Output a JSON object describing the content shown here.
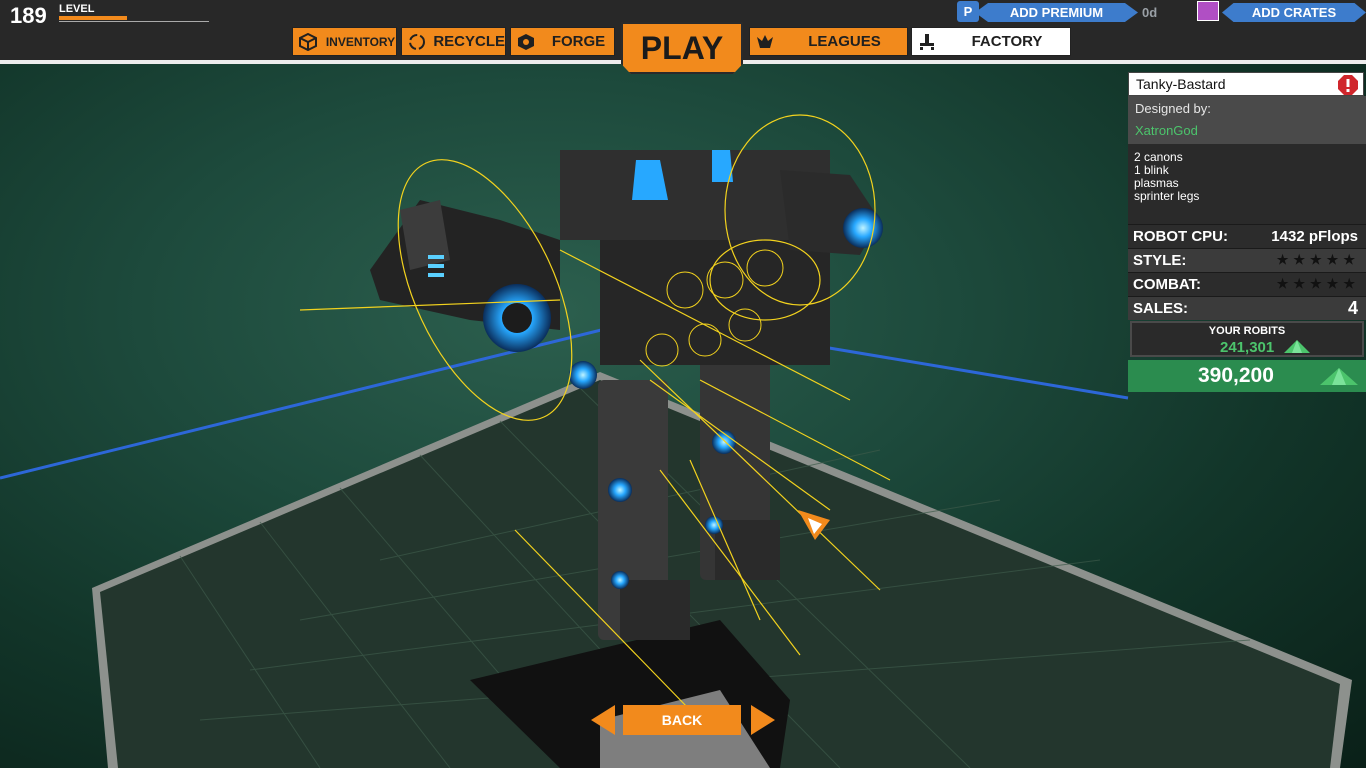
{
  "player": {
    "level": "189",
    "level_label": "LEVEL",
    "xp_progress": 0.45
  },
  "nav": {
    "inventory": "INVENTORY",
    "recycle": "RECYCLE",
    "forge": "FORGE",
    "play": "PLAY",
    "leagues": "LEAGUES",
    "factory": "FACTORY"
  },
  "premium": {
    "label": "ADD PREMIUM",
    "days": "0d"
  },
  "crates": {
    "label": "ADD CRATES"
  },
  "robot": {
    "name": "Tanky-Bastard",
    "designed_by_label": "Designed by:",
    "designer": "XatronGod",
    "description": [
      "2 canons",
      "1 blink",
      "plasmas",
      "sprinter legs"
    ],
    "cpu_label": "ROBOT CPU:",
    "cpu_value": "1432 pFlops",
    "style_label": "STYLE:",
    "style_rating": 0,
    "combat_label": "COMBAT:",
    "combat_rating": 0,
    "sales_label": "SALES:",
    "sales_value": "4",
    "your_robits_label": "YOUR ROBITS",
    "your_robits": "241,301",
    "price": "390,200"
  },
  "footer": {
    "back": "BACK"
  },
  "colors": {
    "accent": "#f28a1c",
    "premium": "#3d7ccc",
    "robits": "#4cc46c",
    "price_bg": "#2b8c4f",
    "hologram": "#f2d21e",
    "glow": "#27a8ff"
  }
}
